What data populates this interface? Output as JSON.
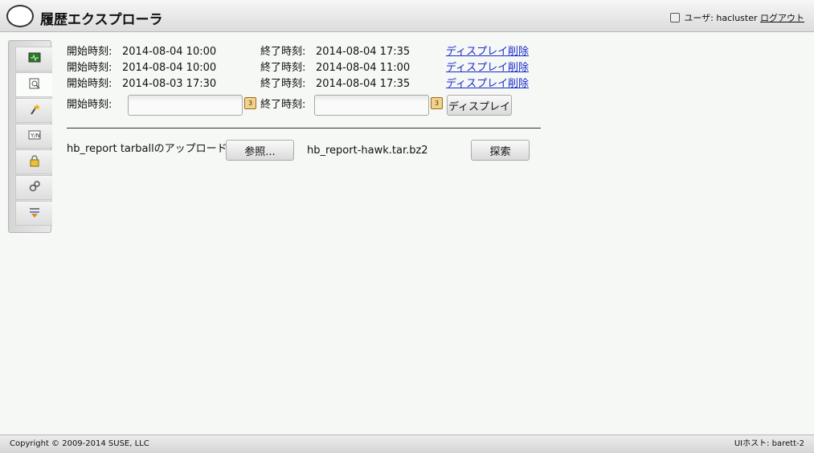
{
  "header": {
    "title": "履歴エクスプローラ",
    "user_prefix": "ユーザ: hacluster",
    "logout": "ログアウト"
  },
  "sidebar": {
    "items": [
      {
        "icon": "monitor-icon"
      },
      {
        "icon": "history-explorer-icon"
      },
      {
        "icon": "wizard-wand-icon"
      },
      {
        "icon": "tags-icon"
      },
      {
        "icon": "lock-icon"
      },
      {
        "icon": "gears-icon"
      },
      {
        "icon": "simulator-icon"
      }
    ]
  },
  "history": {
    "start_label": "開始時刻:",
    "end_label": "終了時刻:",
    "entries": [
      {
        "start": "2014-08-04 10:00",
        "end": "2014-08-04 17:35",
        "display": "ディスプレイ",
        "delete": "削除"
      },
      {
        "start": "2014-08-04 10:00",
        "end": "2014-08-04 11:00",
        "display": "ディスプレイ",
        "delete": "削除"
      },
      {
        "start": "2014-08-03 17:30",
        "end": "2014-08-04 17:35",
        "display": "ディスプレイ",
        "delete": "削除"
      }
    ],
    "form": {
      "start_label": "開始時刻:",
      "end_label": "終了時刻:",
      "start_value": "",
      "end_value": "",
      "calendar_glyph": "3",
      "display_button": "ディスプレイ"
    }
  },
  "upload": {
    "label": "hb_report tarballのアップロード",
    "browse_button": "参照...",
    "filename": "hb_report-hawk.tar.bz2",
    "explore_button": "探索"
  },
  "footer": {
    "copyright": "Copyright © 2009-2014 SUSE, LLC",
    "host": "UIホスト: barett-2"
  },
  "colors": {
    "link": "#1a2cd0",
    "background": "#f5f8f4"
  }
}
